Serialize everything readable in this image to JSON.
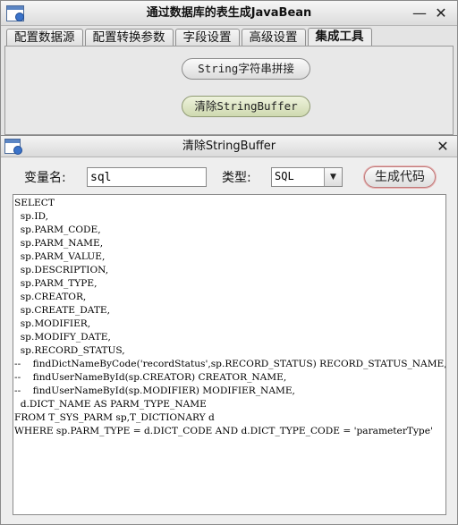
{
  "main_window": {
    "title": "通过数据库的表生成JavaBean",
    "minimize_label": "—",
    "close_label": "✕",
    "tabs": [
      {
        "label": "配置数据源"
      },
      {
        "label": "配置转换参数"
      },
      {
        "label": "字段设置"
      },
      {
        "label": "高级设置"
      },
      {
        "label": "集成工具"
      }
    ],
    "active_tab": "集成工具",
    "buttons": {
      "string_concat": "String字符串拼接",
      "clear_stringbuffer": "清除StringBuffer"
    }
  },
  "dialog": {
    "title": "清除StringBuffer",
    "close_label": "✕",
    "variable_label": "变量名:",
    "variable_value": "sql",
    "type_label": "类型:",
    "type_value": "SQL",
    "generate_button": "生成代码",
    "code_lines": [
      "SELECT",
      "  sp.ID,",
      "  sp.PARM_CODE,",
      "  sp.PARM_NAME,",
      "  sp.PARM_VALUE,",
      "  sp.DESCRIPTION,",
      "  sp.PARM_TYPE,",
      "  sp.CREATOR,",
      "  sp.CREATE_DATE,",
      "  sp.MODIFIER,",
      "  sp.MODIFY_DATE,",
      "  sp.RECORD_STATUS,",
      "--    findDictNameByCode('recordStatus',sp.RECORD_STATUS) RECORD_STATUS_NAME,",
      "--    findUserNameById(sp.CREATOR) CREATOR_NAME,",
      "--    findUserNameById(sp.MODIFIER) MODIFIER_NAME,",
      "  d.DICT_NAME AS PARM_TYPE_NAME",
      "FROM T_SYS_PARM sp,T_DICTIONARY d",
      "WHERE sp.PARM_TYPE = d.DICT_CODE AND d.DICT_TYPE_CODE = 'parameterType'"
    ]
  }
}
